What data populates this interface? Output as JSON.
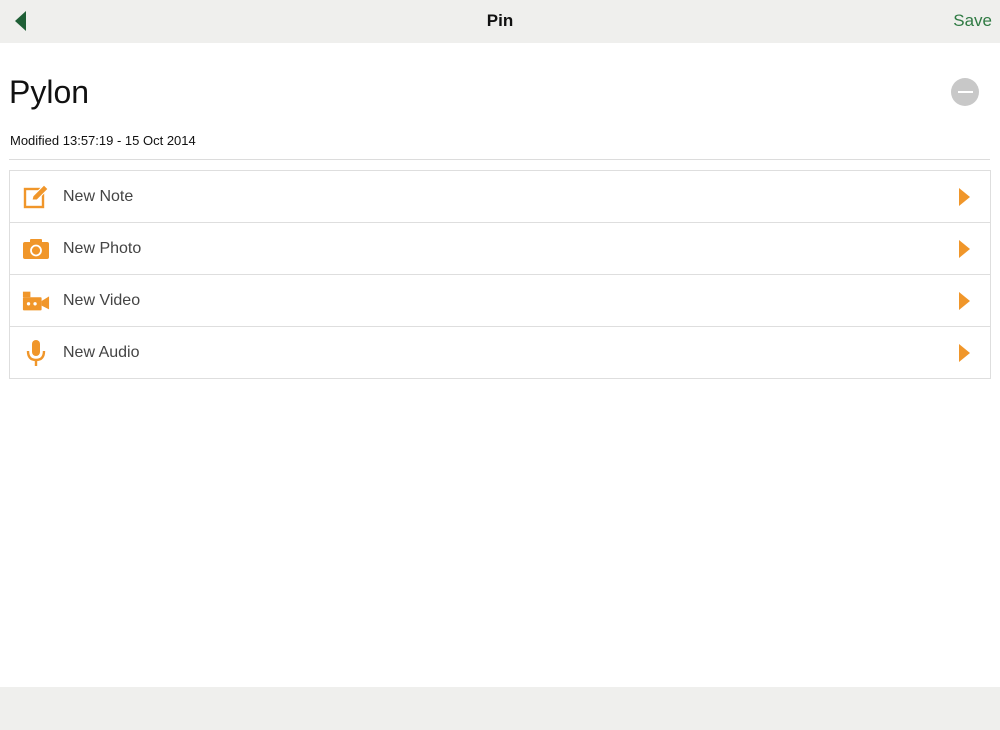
{
  "navbar": {
    "title": "Pin",
    "save_label": "Save"
  },
  "pin": {
    "title": "Pylon",
    "modified": "Modified 13:57:19 - 15 Oct 2014"
  },
  "actions": [
    {
      "label": "New Note",
      "icon": "edit-note-icon"
    },
    {
      "label": "New Photo",
      "icon": "camera-icon"
    },
    {
      "label": "New Video",
      "icon": "video-camera-icon"
    },
    {
      "label": "New Audio",
      "icon": "microphone-icon"
    }
  ],
  "colors": {
    "accent": "#f0962a",
    "brand_green": "#2f7a43",
    "bar_background": "#efefed"
  }
}
